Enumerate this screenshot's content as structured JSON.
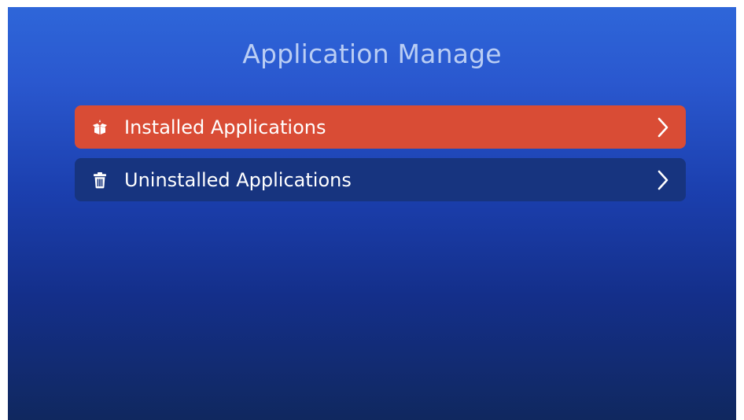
{
  "title": "Application Manage",
  "menu": {
    "items": [
      {
        "label": "Installed Applications",
        "icon": "open-box-icon",
        "selected": true
      },
      {
        "label": "Uninstalled Applications",
        "icon": "trash-icon",
        "selected": false
      }
    ]
  },
  "colors": {
    "selected_item": "#d94c35",
    "normal_item": "#17347f",
    "title_text": "#b9cdf4",
    "background_top": "#2e66d9",
    "background_bottom": "#10285f"
  }
}
